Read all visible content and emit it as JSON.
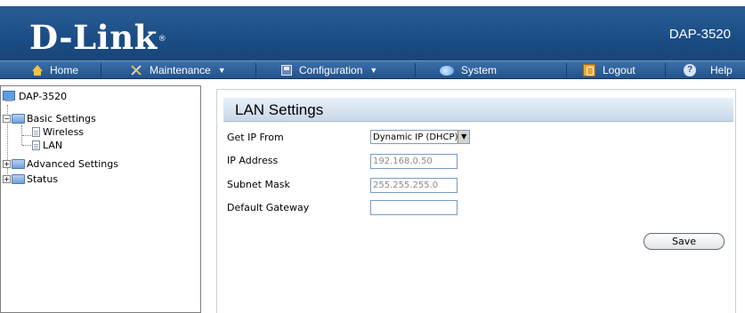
{
  "header": {
    "logo": "D-Link",
    "logo_mark": "®",
    "model": "DAP-3520"
  },
  "menu": {
    "home": "Home",
    "maintenance": "Maintenance",
    "configuration": "Configuration",
    "system": "System",
    "logout": "Logout",
    "help": "Help",
    "dropdown_caret": "▼"
  },
  "tree": {
    "root": "DAP-3520",
    "basic_settings": "Basic Settings",
    "wireless": "Wireless",
    "lan": "LAN",
    "advanced_settings": "Advanced Settings",
    "status": "Status",
    "expanded_symbol": "−",
    "collapsed_symbol": "+"
  },
  "panel": {
    "title": "LAN Settings",
    "fields": {
      "get_ip_from_label": "Get IP From",
      "get_ip_from_value": "Dynamic IP (DHCP)",
      "ip_address_label": "IP Address",
      "ip_address_value": "192.168.0.50",
      "subnet_mask_label": "Subnet Mask",
      "subnet_mask_value": "255.255.255.0",
      "default_gateway_label": "Default Gateway",
      "default_gateway_value": ""
    },
    "save_label": "Save"
  }
}
